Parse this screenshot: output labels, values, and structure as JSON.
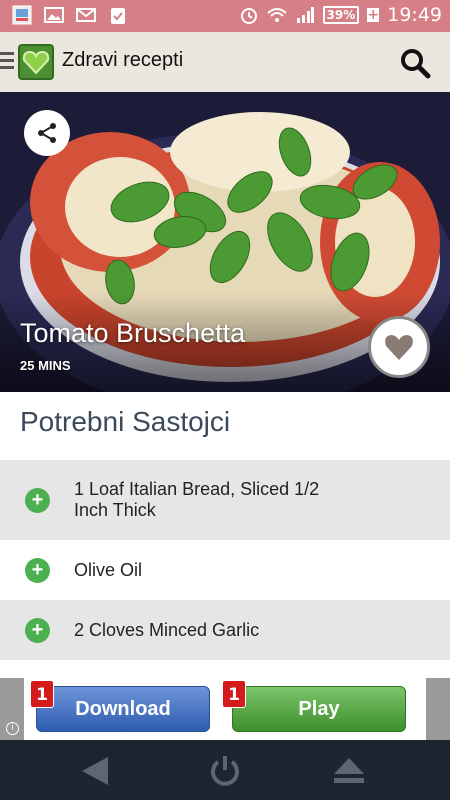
{
  "status_bar": {
    "battery": "39%",
    "time": "19:49",
    "icons": [
      "app-icon",
      "image-icon",
      "gmail-icon",
      "clipboard-icon",
      "alarm-icon",
      "wifi-icon",
      "signal-icon",
      "battery-icon"
    ]
  },
  "app_bar": {
    "title": "Zdravi recepti",
    "icons": [
      "menu-icon",
      "app-logo",
      "search-icon"
    ]
  },
  "hero": {
    "recipe_title": "Tomato Bruschetta",
    "time": "25 MINS",
    "icons": [
      "share-icon",
      "heart-icon"
    ]
  },
  "ingredients": {
    "heading": "Potrebni Sastojci",
    "items": [
      {
        "line1": "1  Loaf   Italian Bread, Sliced 1/2",
        "line2": "Inch Thick"
      },
      {
        "line1": "Olive Oil",
        "line2": ""
      },
      {
        "line1": "2  Cloves  Minced Garlic",
        "line2": ""
      }
    ]
  },
  "ad": {
    "download_label": "Download",
    "play_label": "Play",
    "download_badge": "1",
    "play_badge": "1",
    "info": "i"
  },
  "nav_bar": {
    "icons": [
      "back-icon",
      "power-icon",
      "eject-icon"
    ]
  },
  "colors": {
    "status_bar": "#d77f86",
    "app_bar": "#ebe6de",
    "accent_green": "#4caf50",
    "nav_bar": "#1e2530"
  }
}
